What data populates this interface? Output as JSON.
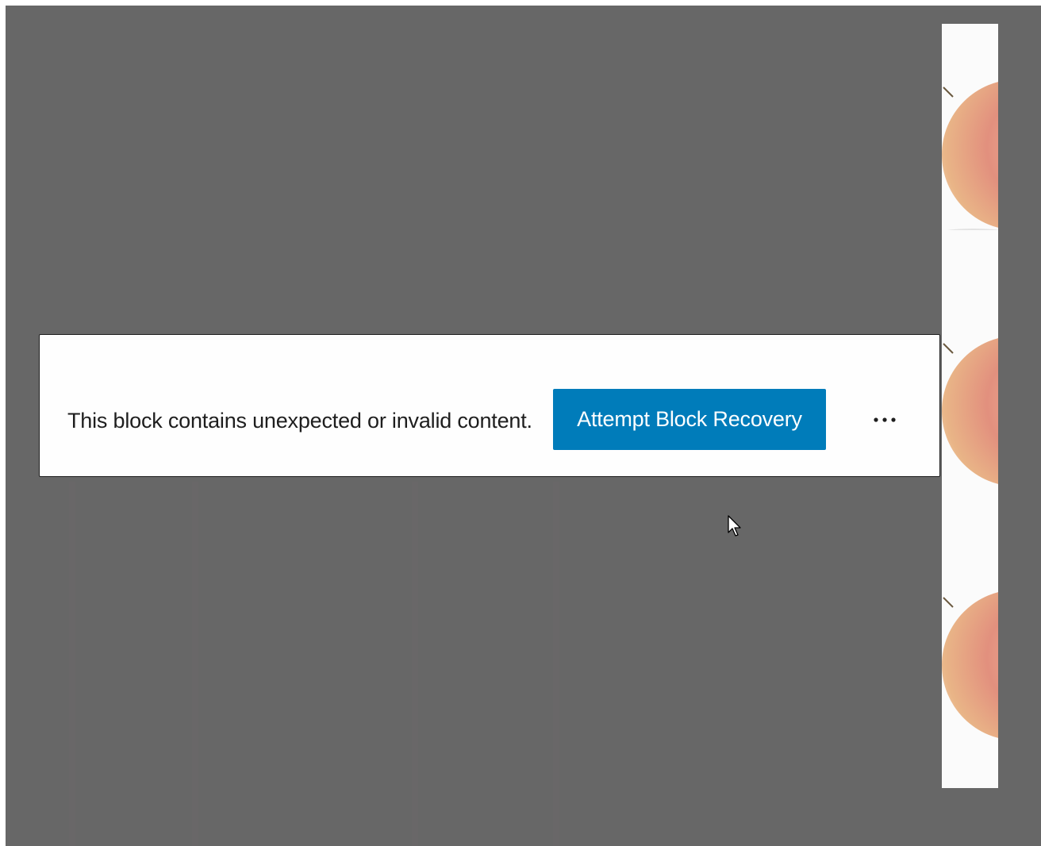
{
  "notice": {
    "message": "This block contains unexpected or invalid content.",
    "recover_button_label": "Attempt Block Recovery",
    "more_options_icon": "ellipsis-icon"
  },
  "colors": {
    "canvas_background": "#676767",
    "notice_background": "#fefefe",
    "button_background": "#007cba",
    "button_text": "#ffffff",
    "text": "#1e1e1e"
  },
  "image_strip": {
    "icon": "apple-image"
  },
  "cursor": {
    "icon": "mouse-pointer-icon"
  }
}
